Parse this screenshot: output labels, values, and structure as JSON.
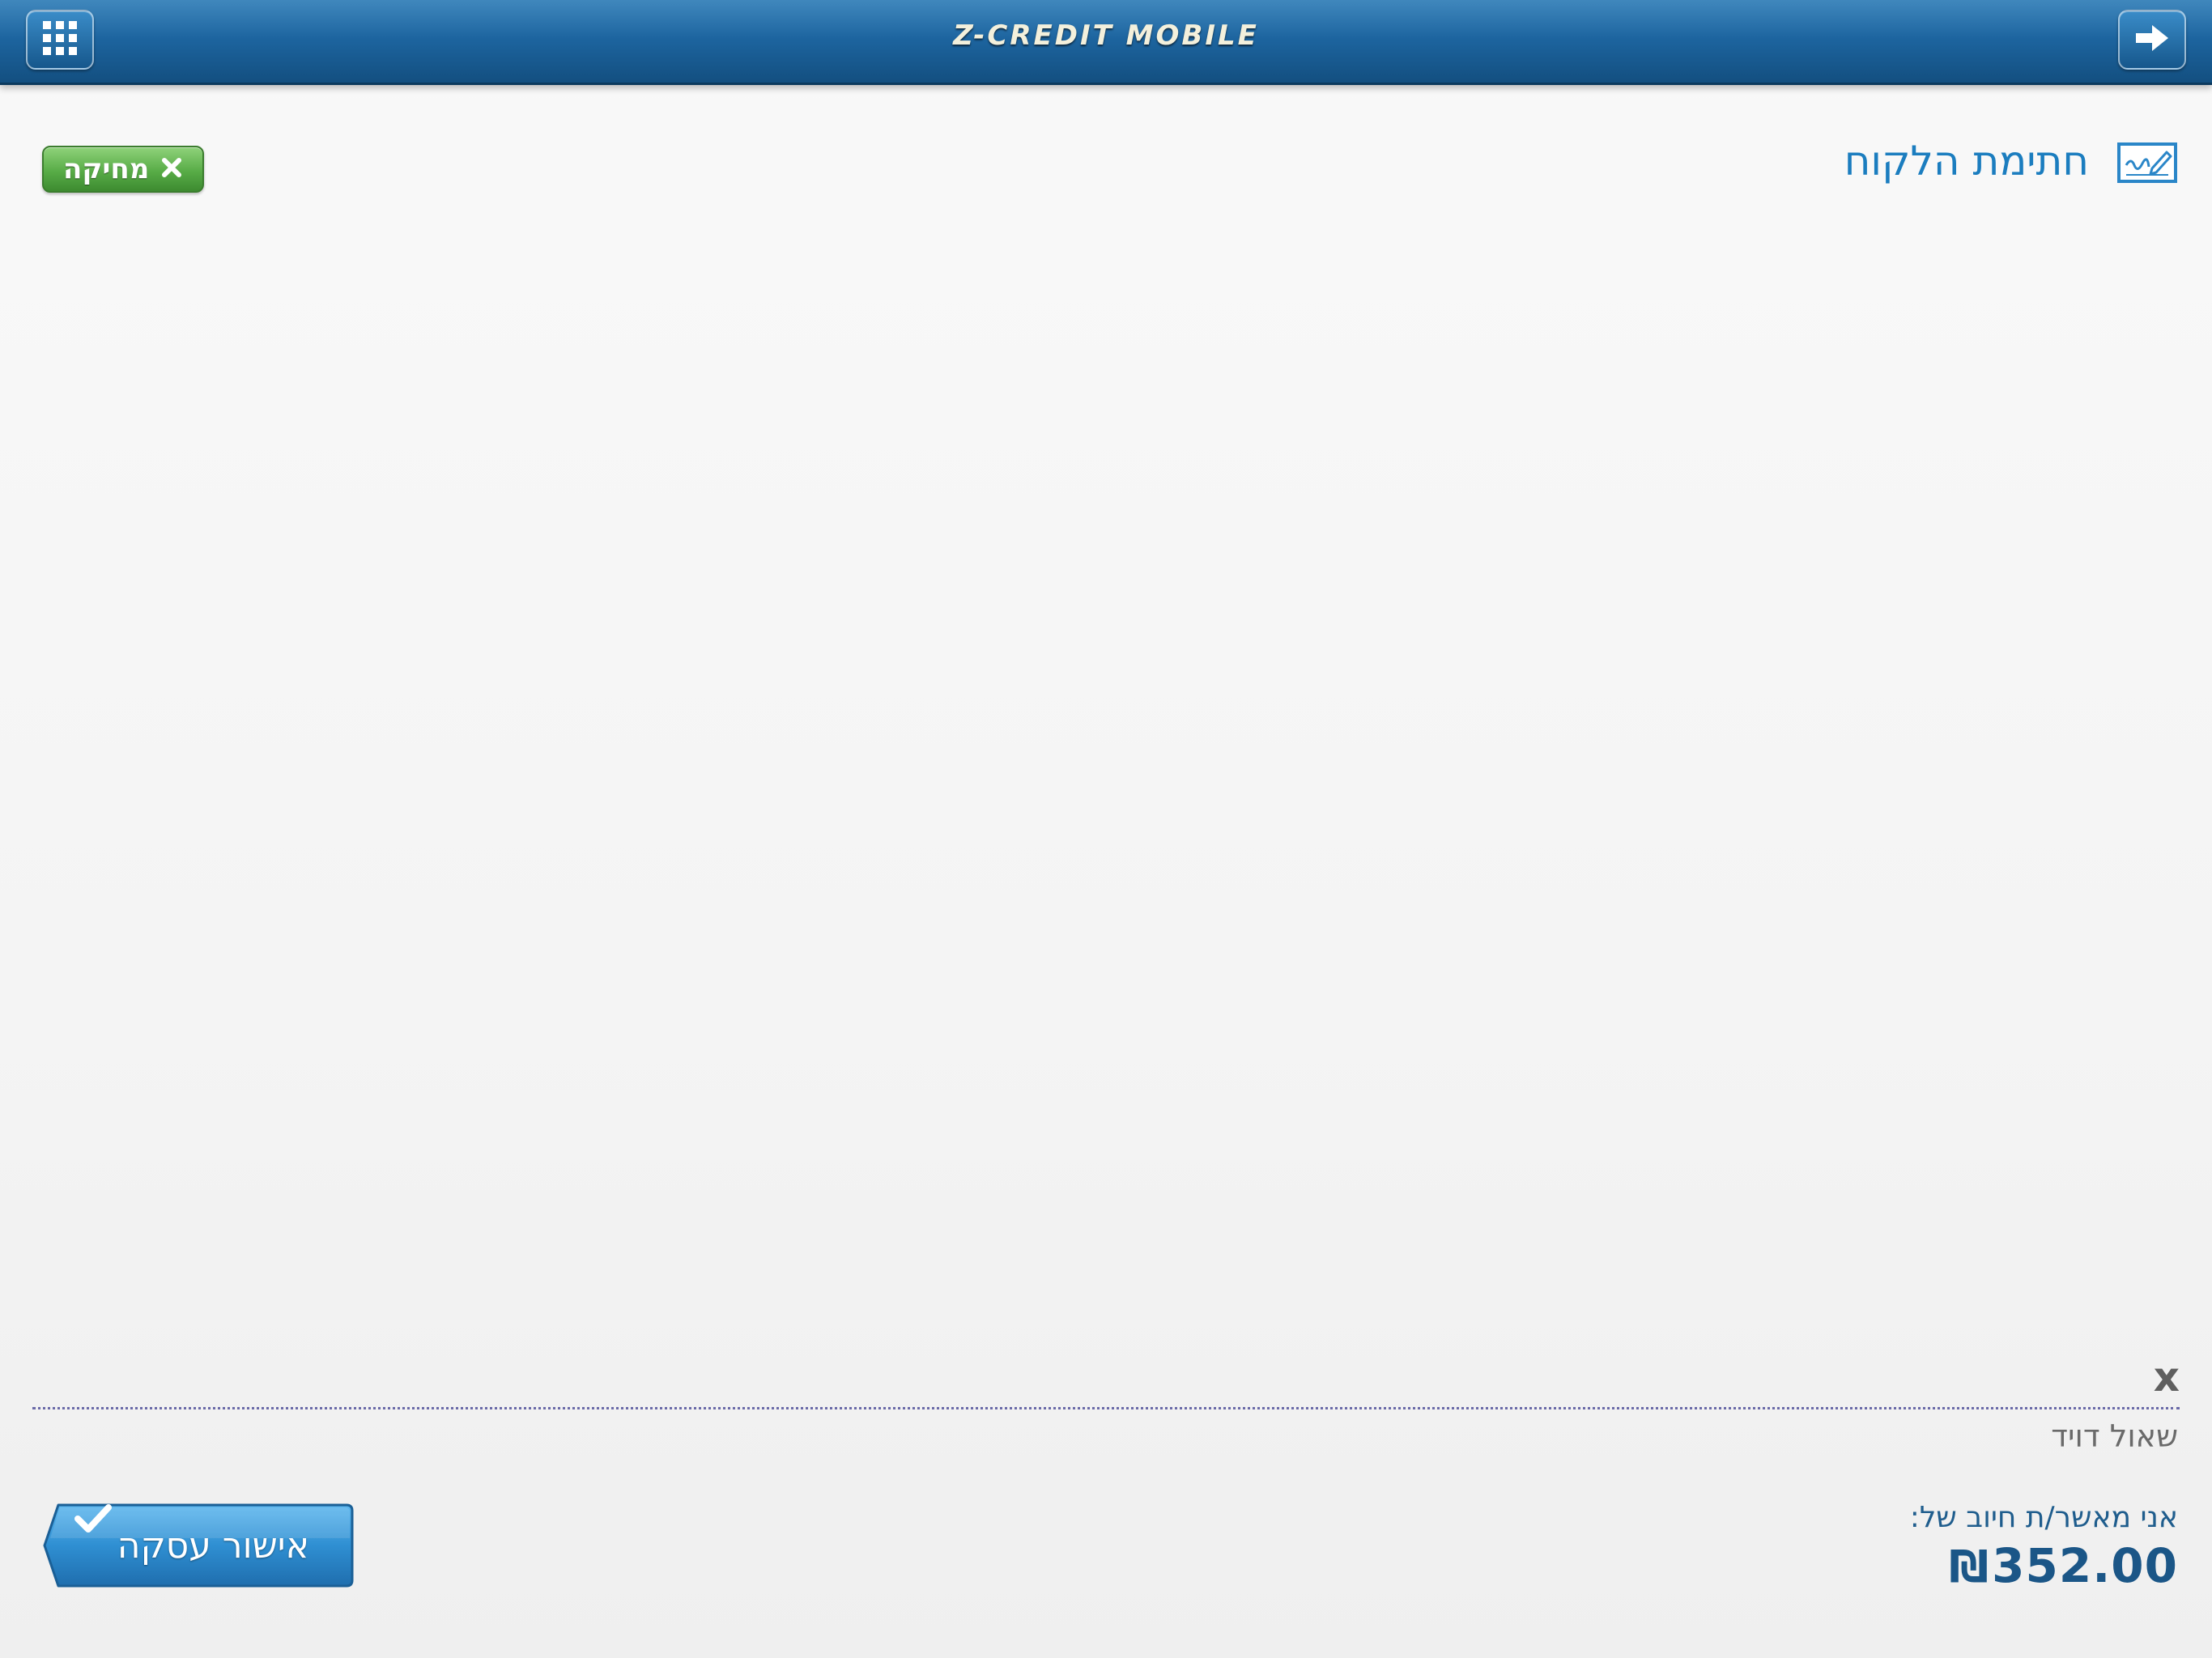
{
  "header": {
    "app_title": "Z-CREDIT MOBILE",
    "menu_icon": "grid-icon",
    "exit_icon": "arrow-right-icon"
  },
  "page": {
    "title": "חתימת הלקוח",
    "title_icon": "signature-icon"
  },
  "clear_button": {
    "label": "מחיקה",
    "icon": "close-icon"
  },
  "signature": {
    "x_mark": "x",
    "customer_name": "שאול דויד"
  },
  "confirmation": {
    "text": "אני מאשר/ת חיוב של:",
    "amount": "352.00",
    "currency": "₪"
  },
  "approve_button": {
    "label": "אישור עסקה",
    "icon": "check-icon"
  },
  "colors": {
    "header": "#1d65a0",
    "title": "#1b7dbf",
    "clear_button": "#58ac47",
    "approve_button": "#2f8fd2",
    "amount": "#1b5687"
  }
}
